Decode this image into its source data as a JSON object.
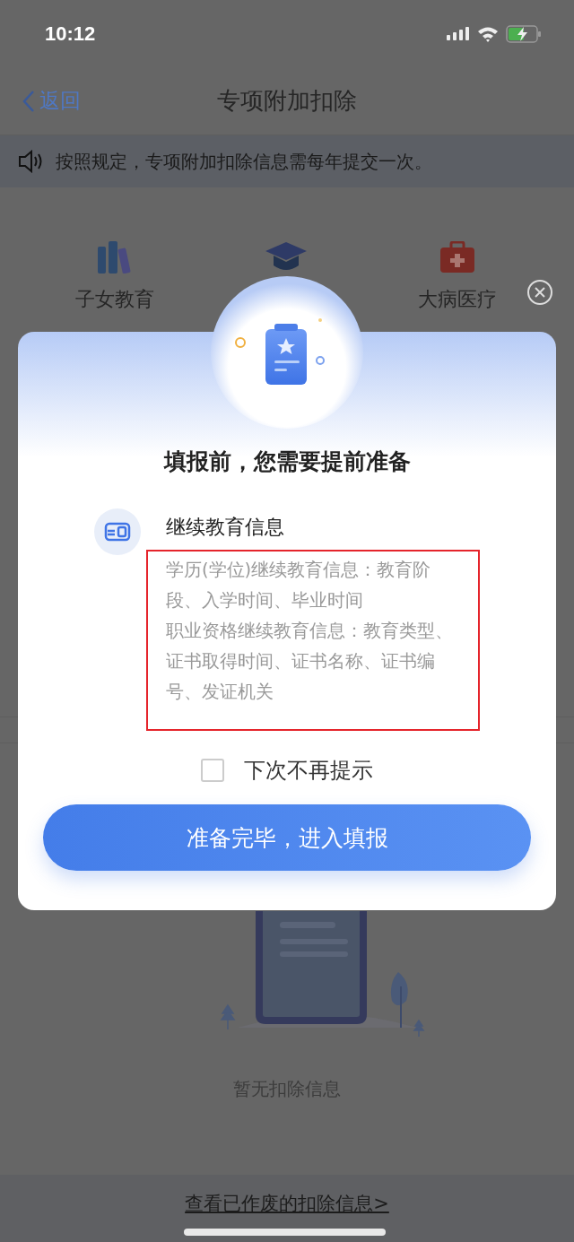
{
  "status_bar": {
    "time": "10:12"
  },
  "nav": {
    "back": "返回",
    "title": "专项附加扣除"
  },
  "notice": {
    "text": "按照规定，专项附加扣除信息需每年提交一次。"
  },
  "categories": [
    {
      "kind": "books",
      "label": "子女教育"
    },
    {
      "kind": "cap"
    },
    {
      "kind": "medkit",
      "label": "大病医疗"
    }
  ],
  "empty_state": {
    "text": "暂无扣除信息"
  },
  "footer": {
    "link": "查看已作废的扣除信息>"
  },
  "dialog": {
    "title": "填报前，您需要提前准备",
    "item": {
      "title": "继续教育信息",
      "lines": [
        "学历(学位)继续教育信息：教育阶段、入学时间、毕业时间",
        "职业资格继续教育信息：教育类型、证书取得时间、证书名称、证书编号、发证机关"
      ]
    },
    "dont_remind": {
      "label": "下次不再提示",
      "checked": false
    },
    "button": "准备完毕，进入填报"
  }
}
